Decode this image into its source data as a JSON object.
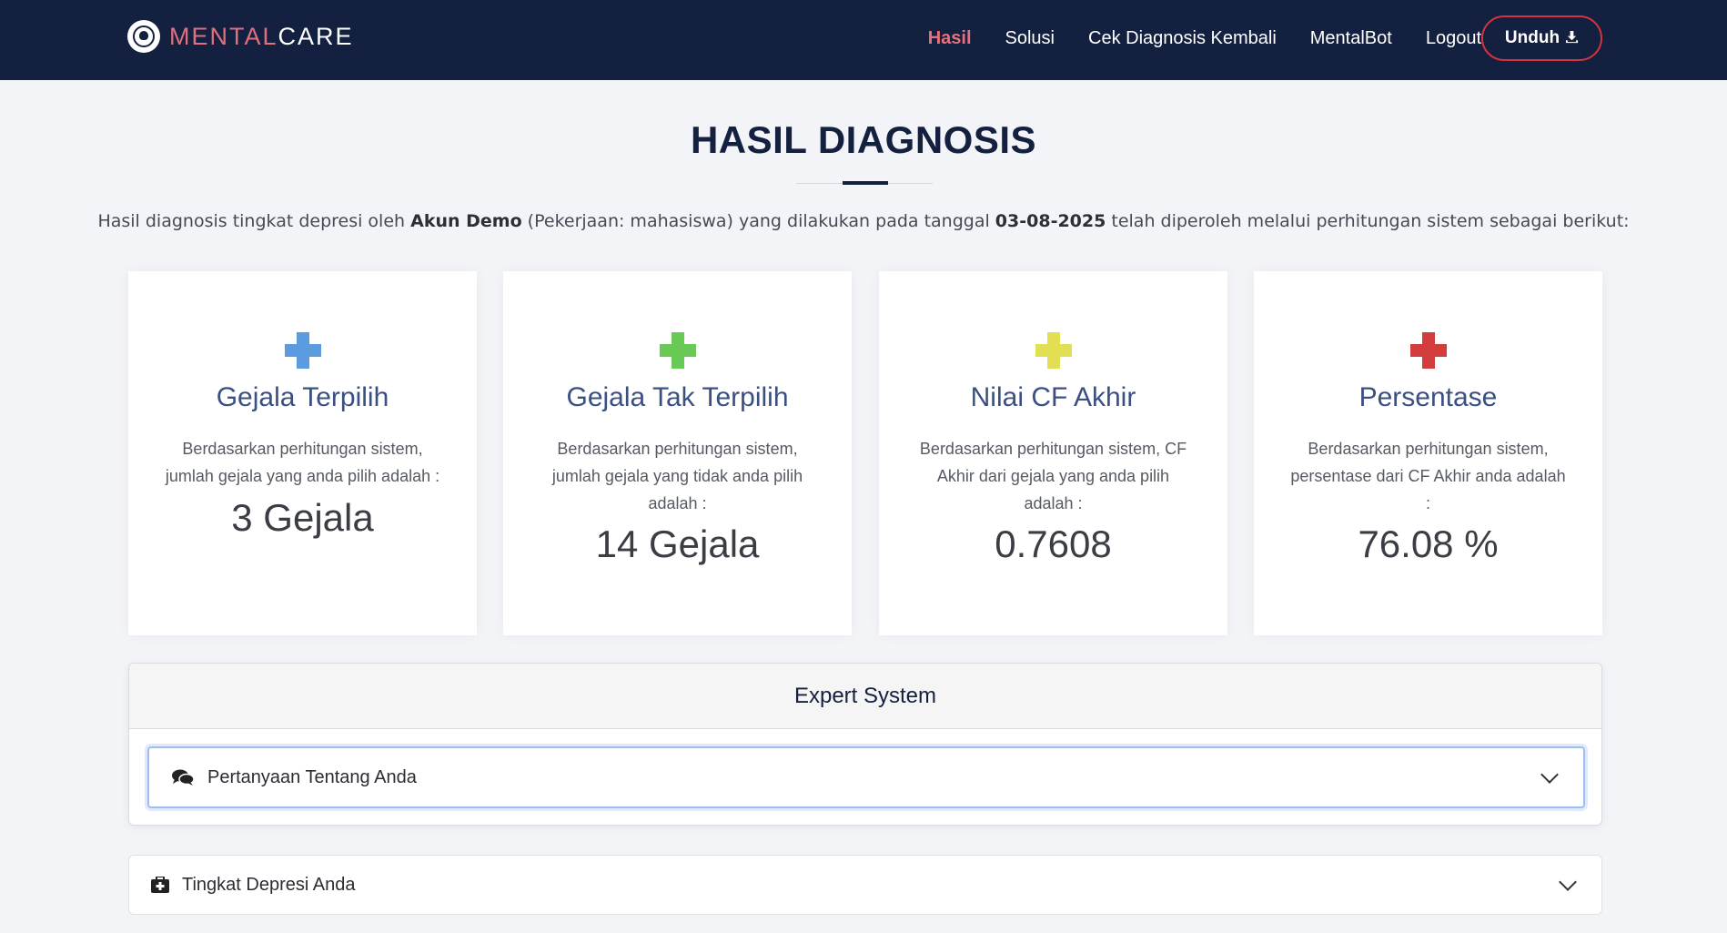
{
  "navbar": {
    "brand_part1": "MENTAL",
    "brand_part2": "CARE",
    "links": [
      "Hasil",
      "Solusi",
      "Cek Diagnosis Kembali",
      "MentalBot",
      "Logout"
    ],
    "download_label": "Unduh",
    "download_icon": "download-icon"
  },
  "page": {
    "title": "HASIL DIAGNOSIS",
    "intro_before_name": "Hasil diagnosis tingkat depresi oleh ",
    "user_name": "Akun Demo",
    "intro_mid": " (Pekerjaan: mahasiswa) yang dilakukan pada tanggal ",
    "date": "03-08-2025",
    "intro_after": " telah diperoleh melalui perhitungan sistem sebagai berikut:"
  },
  "cards": [
    {
      "icon": "plus-icon",
      "color": "#5b9bdf",
      "title": "Gejala Terpilih",
      "desc": "Berdasarkan perhitungan sistem, jumlah gejala yang anda pilih adalah :",
      "value": "3 Gejala"
    },
    {
      "icon": "plus-icon",
      "color": "#69c955",
      "title": "Gejala Tak Terpilih",
      "desc": "Berdasarkan perhitungan sistem, jumlah gejala yang tidak anda pilih adalah :",
      "value": "14 Gejala"
    },
    {
      "icon": "plus-icon",
      "color": "#e3df52",
      "title": "Nilai CF Akhir",
      "desc": "Berdasarkan perhitungan sistem, CF Akhir dari gejala yang anda pilih adalah :",
      "value": "0.7608"
    },
    {
      "icon": "plus-icon",
      "color": "#d33c3c",
      "title": "Persentase",
      "desc": "Berdasarkan perhitungan sistem, persentase dari CF Akhir anda adalah :",
      "value": "76.08 %"
    }
  ],
  "expert": {
    "header": "Expert System",
    "accordion_label": "Pertanyaan Tentang Anda",
    "accordion_icon": "comments-icon"
  },
  "depression": {
    "label": "Tingkat Depresi Anda",
    "icon": "medkit-icon"
  }
}
